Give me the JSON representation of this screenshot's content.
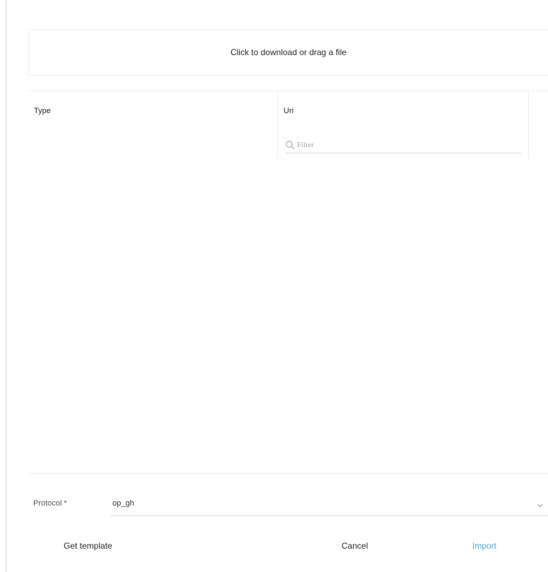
{
  "upload": {
    "label": "Click to download or drag a file"
  },
  "table": {
    "columns": [
      {
        "key": "type",
        "label": "Type"
      },
      {
        "key": "uri",
        "label": "Uri"
      }
    ],
    "filter": {
      "placeholder": "Filter",
      "icon": "search-icon"
    },
    "rows": []
  },
  "form": {
    "protocol": {
      "label": "Protocol *",
      "value": "op_gh",
      "icon": "chevron-down-icon"
    }
  },
  "actions": {
    "get_template": "Get template",
    "cancel": "Cancel",
    "import": "Import"
  },
  "colors": {
    "accent": "#4fa7d8",
    "text": "#2a2a2a",
    "border": "#f0f0f0"
  }
}
